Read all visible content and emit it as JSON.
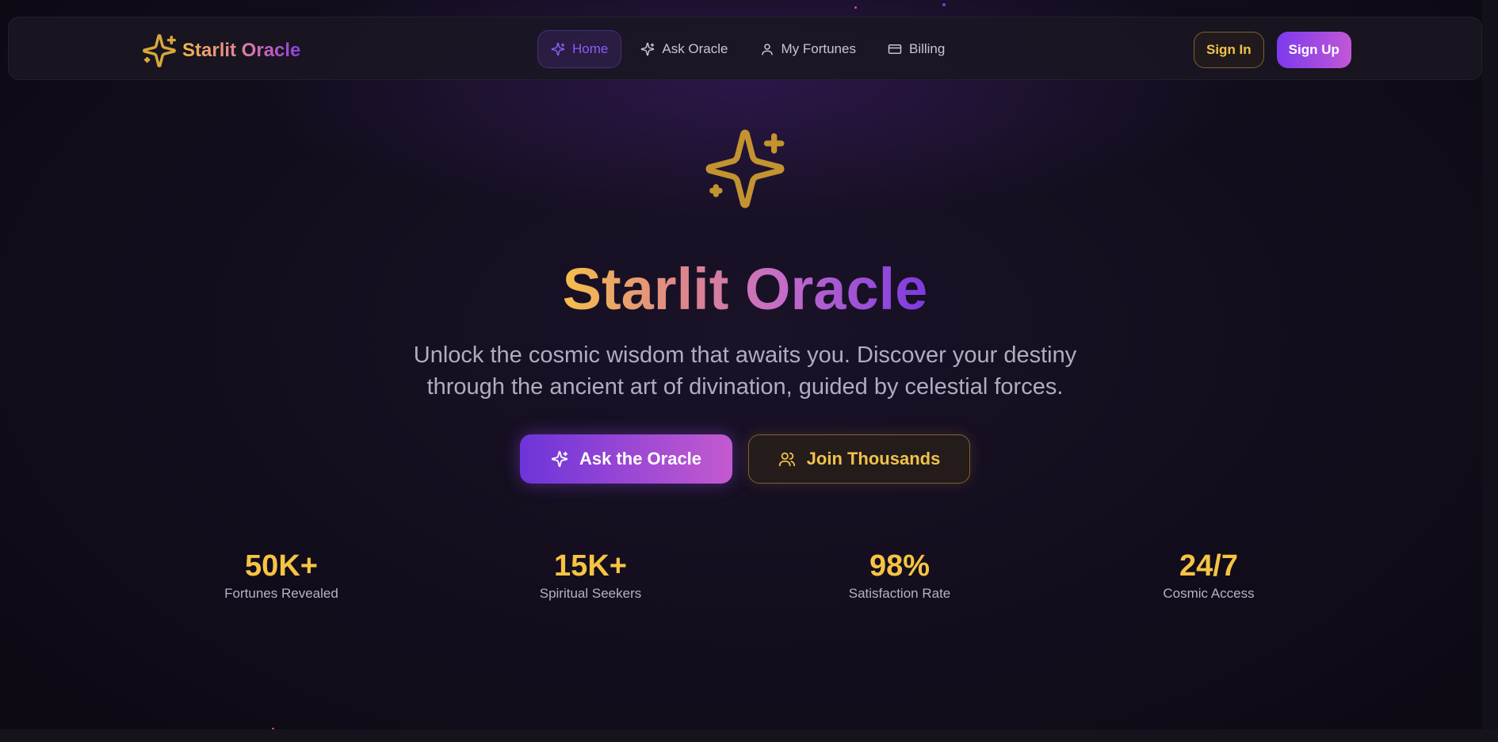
{
  "brand": {
    "name": "Starlit Oracle",
    "icon": "sparkles-icon"
  },
  "nav": {
    "items": [
      {
        "label": "Home",
        "icon": "sparkles-icon",
        "active": true
      },
      {
        "label": "Ask Oracle",
        "icon": "sparkles-icon",
        "active": false
      },
      {
        "label": "My Fortunes",
        "icon": "user-icon",
        "active": false
      },
      {
        "label": "Billing",
        "icon": "credit-card-icon",
        "active": false
      }
    ]
  },
  "auth": {
    "sign_in": "Sign In",
    "sign_up": "Sign Up"
  },
  "hero": {
    "icon": "sparkles-icon",
    "title": "Starlit Oracle",
    "subtitle_line1": "Unlock the cosmic wisdom that awaits you. Discover your destiny",
    "subtitle_line2": "through the ancient art of divination, guided by celestial forces.",
    "primary_cta": "Ask the Oracle",
    "secondary_cta": "Join Thousands"
  },
  "stats": [
    {
      "value": "50K+",
      "label": "Fortunes Revealed"
    },
    {
      "value": "15K+",
      "label": "Spiritual Seekers"
    },
    {
      "value": "98%",
      "label": "Satisfaction Rate"
    },
    {
      "value": "24/7",
      "label": "Cosmic Access"
    }
  ],
  "colors": {
    "gold": "#f6c443",
    "purple": "#7c3aed",
    "pink": "#c257d6",
    "background": "#120d1c",
    "muted_text": "#b2abc1"
  }
}
